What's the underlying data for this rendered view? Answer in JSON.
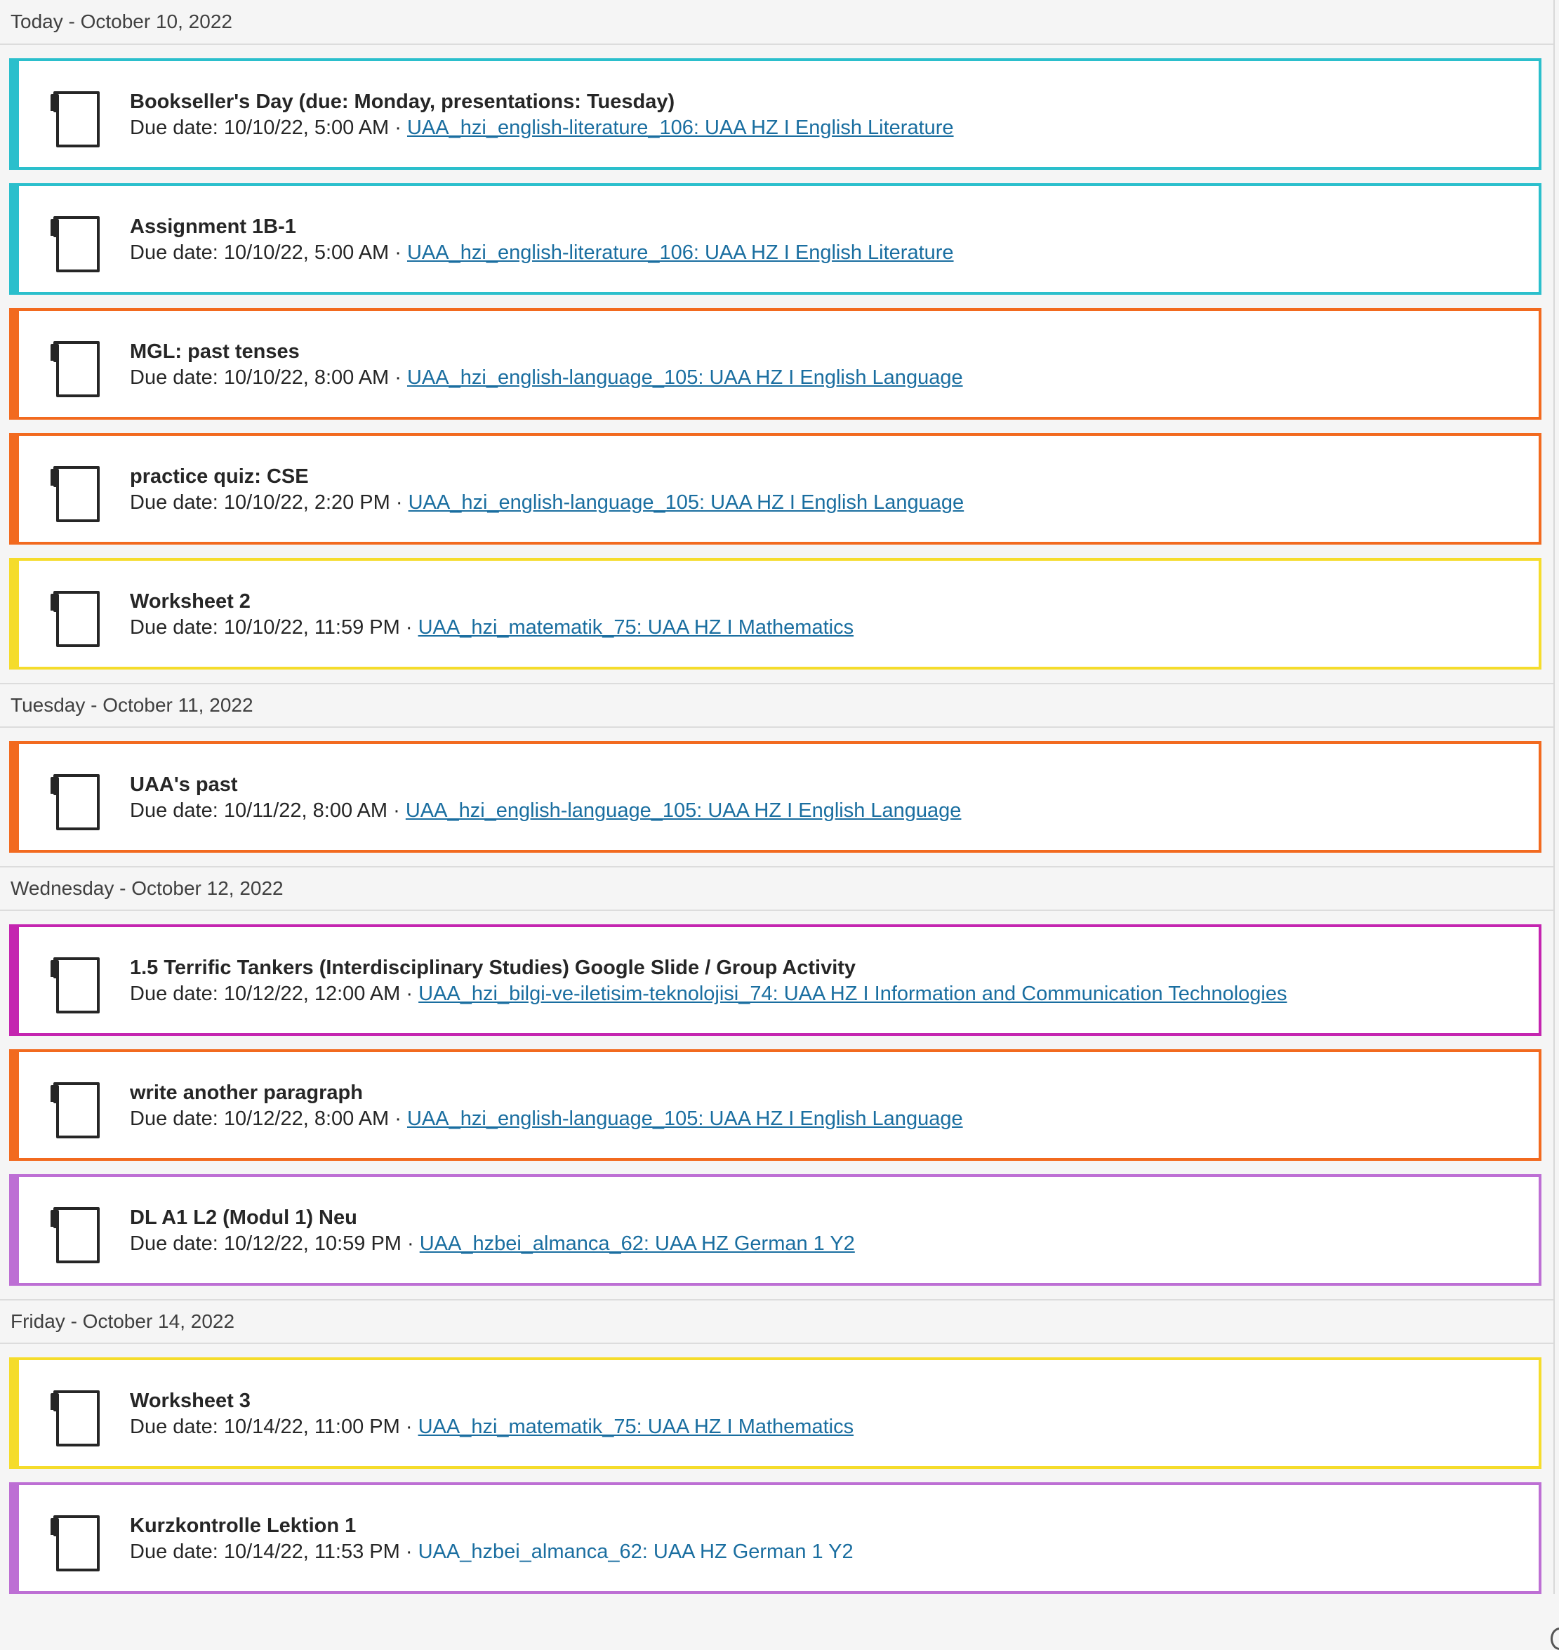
{
  "colors": {
    "english_literature": "#2bbfcc",
    "english_language": "#f26a1f",
    "mathematics": "#f5dc2b",
    "ict": "#c425b0",
    "german": "#bd6fd4",
    "link": "#1a6ea0"
  },
  "icon": "assignment-icon",
  "days": [
    {
      "header": "Today - October 10, 2022",
      "items": [
        {
          "title": "Bookseller's Day (due: Monday, presentations: Tuesday)",
          "due": "Due date: 10/10/22, 5:00 AM · ",
          "course": "UAA_hzi_english-literature_106: UAA HZ I English Literature",
          "color": "english_literature"
        },
        {
          "title": "Assignment 1B-1",
          "due": "Due date: 10/10/22, 5:00 AM · ",
          "course": "UAA_hzi_english-literature_106: UAA HZ I English Literature",
          "color": "english_literature"
        },
        {
          "title": "MGL: past tenses",
          "due": "Due date: 10/10/22, 8:00 AM · ",
          "course": "UAA_hzi_english-language_105: UAA HZ I English Language",
          "color": "english_language"
        },
        {
          "title": "practice quiz: CSE",
          "due": "Due date: 10/10/22, 2:20 PM · ",
          "course": "UAA_hzi_english-language_105: UAA HZ I English Language",
          "color": "english_language"
        },
        {
          "title": "Worksheet 2",
          "due": "Due date: 10/10/22, 11:59 PM · ",
          "course": "UAA_hzi_matematik_75: UAA HZ I Mathematics",
          "color": "mathematics"
        }
      ]
    },
    {
      "header": "Tuesday - October 11, 2022",
      "items": [
        {
          "title": "UAA's past",
          "due": "Due date: 10/11/22, 8:00 AM · ",
          "course": "UAA_hzi_english-language_105: UAA HZ I English Language",
          "color": "english_language"
        }
      ]
    },
    {
      "header": "Wednesday - October 12, 2022",
      "items": [
        {
          "title": "1.5 Terrific Tankers (Interdisciplinary Studies) Google Slide / Group Activity",
          "due": "Due date: 10/12/22, 12:00 AM · ",
          "course": "UAA_hzi_bilgi-ve-iletisim-teknolojisi_74: UAA HZ I Information and Communication Technologies",
          "color": "ict"
        },
        {
          "title": "write another paragraph",
          "due": "Due date: 10/12/22, 8:00 AM · ",
          "course": "UAA_hzi_english-language_105: UAA HZ I English Language",
          "color": "english_language"
        },
        {
          "title": "DL A1 L2 (Modul 1) Neu",
          "due": "Due date: 10/12/22, 10:59 PM · ",
          "course": "UAA_hzbei_almanca_62: UAA HZ German 1 Y2",
          "color": "german"
        }
      ]
    },
    {
      "header": "Friday - October 14, 2022",
      "items": [
        {
          "title": "Worksheet 3",
          "due": "Due date: 10/14/22, 11:00 PM · ",
          "course": "UAA_hzi_matematik_75: UAA HZ I Mathematics",
          "color": "mathematics"
        },
        {
          "title": "Kurzkontrolle Lektion 1",
          "due": "Due date: 10/14/22, 11:53 PM · ",
          "course": "UAA_hzbei_almanca_62: UAA HZ German 1 Y2",
          "color": "german"
        }
      ]
    }
  ]
}
